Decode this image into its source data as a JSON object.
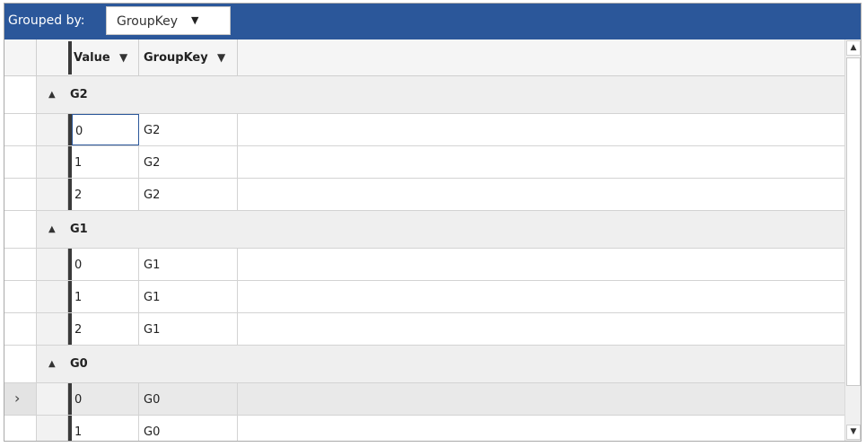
{
  "toolbar": {
    "grouped_by_label": "Grouped by:",
    "group_combo": {
      "value": "GroupKey",
      "icon": "triangle-down-icon"
    }
  },
  "grid": {
    "columns": [
      {
        "title": "Value",
        "filter_icon": "filter-icon"
      },
      {
        "title": "GroupKey",
        "filter_icon": "filter-icon"
      }
    ],
    "groups": [
      {
        "key": "G2",
        "expanded": true,
        "rows": [
          {
            "value": "0",
            "group_key": "G2"
          },
          {
            "value": "1",
            "group_key": "G2"
          },
          {
            "value": "2",
            "group_key": "G2"
          }
        ]
      },
      {
        "key": "G1",
        "expanded": true,
        "rows": [
          {
            "value": "0",
            "group_key": "G1"
          },
          {
            "value": "1",
            "group_key": "G1"
          },
          {
            "value": "2",
            "group_key": "G1"
          }
        ]
      },
      {
        "key": "G0",
        "expanded": true,
        "rows": [
          {
            "value": "0",
            "group_key": "G0"
          },
          {
            "value": "1",
            "group_key": "G0"
          }
        ]
      }
    ],
    "current_row_indicator": "chevron-right-icon"
  },
  "scrollbar": {
    "up_icon": "scroll-up-icon",
    "down_icon": "scroll-down-icon"
  }
}
